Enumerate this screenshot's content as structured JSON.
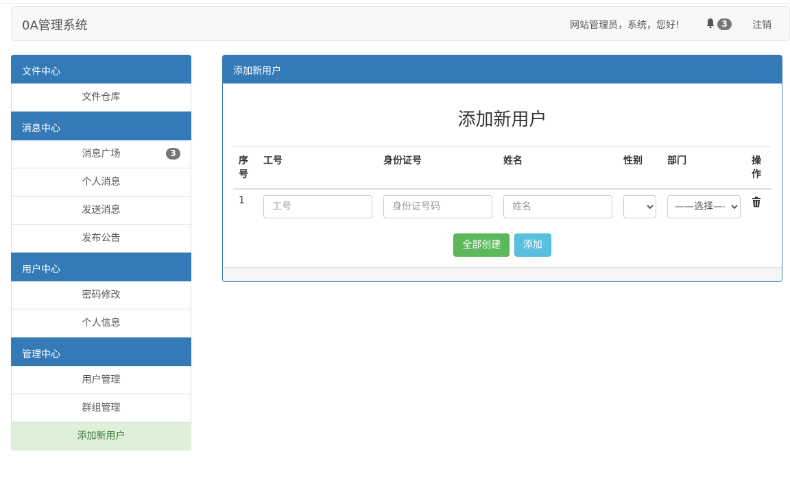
{
  "navbar": {
    "brand": "0A管理系统",
    "greeting": "网站管理员，系统，您好!",
    "notification_count": "3",
    "logout": "注销"
  },
  "sidebar": {
    "sections": [
      {
        "title": "文件中心",
        "items": [
          {
            "label": "文件仓库"
          }
        ]
      },
      {
        "title": "消息中心",
        "items": [
          {
            "label": "消息广场",
            "badge": "3"
          },
          {
            "label": "个人消息"
          },
          {
            "label": "发送消息"
          },
          {
            "label": "发布公告"
          }
        ]
      },
      {
        "title": "用户中心",
        "items": [
          {
            "label": "密码修改"
          },
          {
            "label": "个人信息"
          }
        ]
      },
      {
        "title": "管理中心",
        "items": [
          {
            "label": "用户管理"
          },
          {
            "label": "群组管理"
          },
          {
            "label": "添加新用户",
            "active": true
          }
        ]
      }
    ]
  },
  "panel": {
    "heading": "添加新用户",
    "title": "添加新用户",
    "table": {
      "headers": [
        "序号",
        "工号",
        "身份证号",
        "姓名",
        "性别",
        "部门",
        "操作"
      ],
      "rows": [
        {
          "index": "1",
          "employee_id_placeholder": "工号",
          "id_card_placeholder": "身份证号码",
          "name_placeholder": "姓名",
          "gender_value": "",
          "department_value": "——选择——"
        }
      ]
    },
    "buttons": {
      "create_all": "全部创建",
      "add": "添加"
    }
  },
  "colors": {
    "primary": "#337ab7",
    "success": "#5cb85c",
    "info": "#5bc0de",
    "active_bg": "#dff0d8"
  },
  "icons": {
    "notification": "bell-icon",
    "delete": "trash-icon"
  }
}
